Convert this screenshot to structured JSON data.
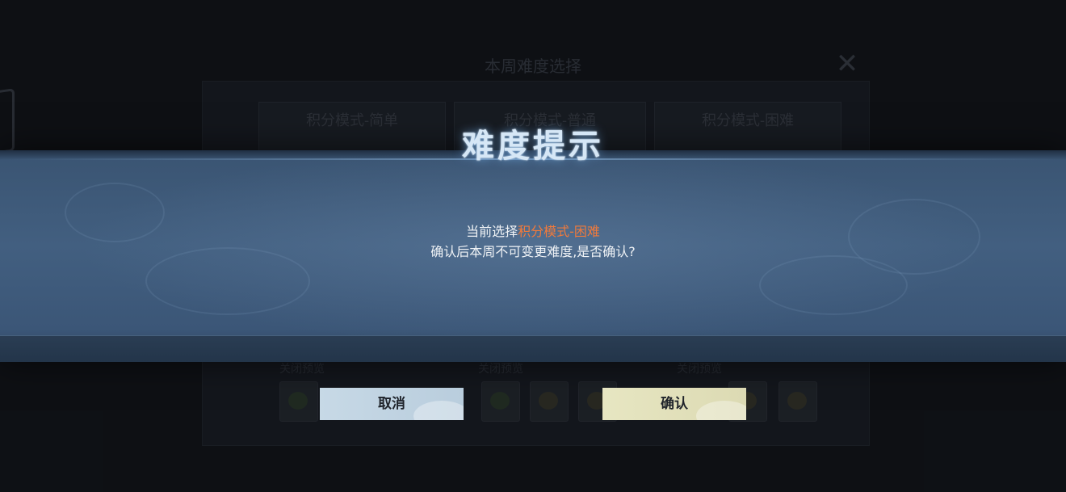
{
  "background": {
    "title": "本周难度选择",
    "tabs": [
      "积分模式-简单",
      "积分模式-普通",
      "积分模式-困难"
    ],
    "preview_labels": [
      "关闭预览",
      "关闭预览",
      "关闭预览"
    ]
  },
  "dialog": {
    "title": "难度提示",
    "line1_prefix": "当前选择",
    "line1_highlight": "积分模式-困难",
    "line2": "确认后本周不可变更难度,是否确认?",
    "cancel_label": "取消",
    "confirm_label": "确认"
  },
  "colors": {
    "highlight": "#f07a3c",
    "cancel_button": "#c7d9e6",
    "confirm_button": "#e7e6c2",
    "banner": "#425f80"
  }
}
